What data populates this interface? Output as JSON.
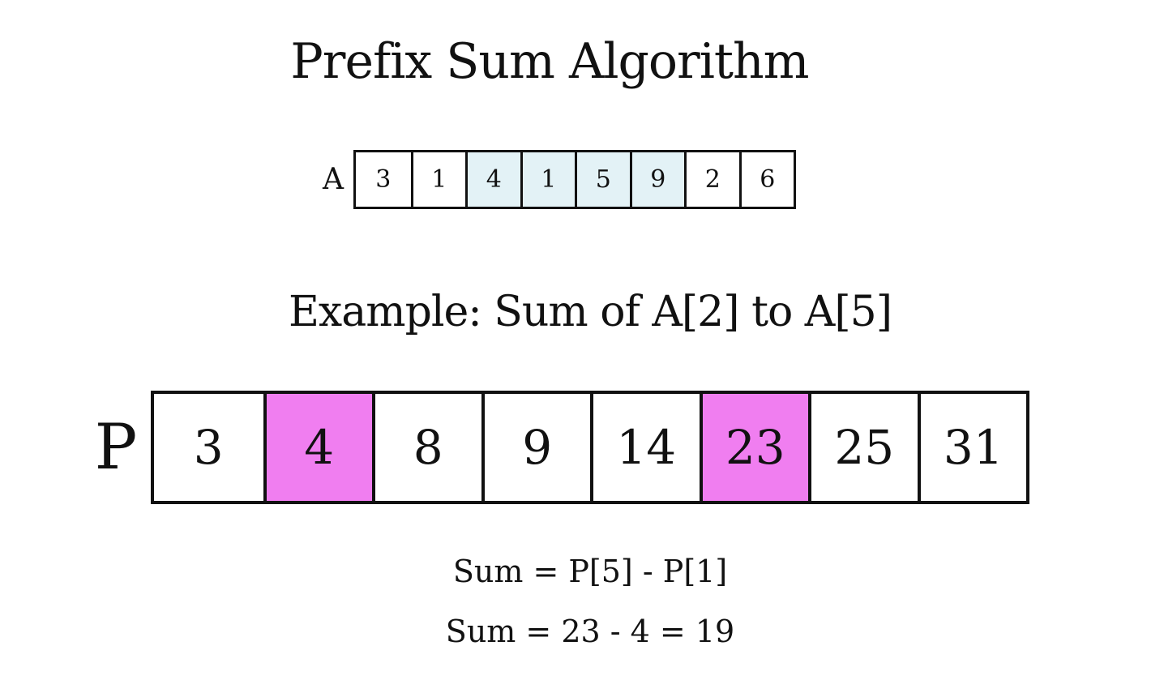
{
  "title": "Prefix Sum Algorithm",
  "array_a": {
    "label": "A",
    "values": [
      "3",
      "1",
      "4",
      "1",
      "5",
      "9",
      "2",
      "6"
    ],
    "highlighted_indices": [
      2,
      3,
      4,
      5
    ],
    "highlight_color": "#e3f2f6"
  },
  "example": "Example: Sum of A[2] to A[5]",
  "array_p": {
    "label": "P",
    "values": [
      "3",
      "4",
      "8",
      "9",
      "14",
      "23",
      "25",
      "31"
    ],
    "highlighted_indices": [
      1,
      5
    ],
    "highlight_color": "#f07ef0"
  },
  "formulas": {
    "line1": "Sum = P[5] - P[1]",
    "line2": "Sum = 23 - 4 = 19"
  }
}
